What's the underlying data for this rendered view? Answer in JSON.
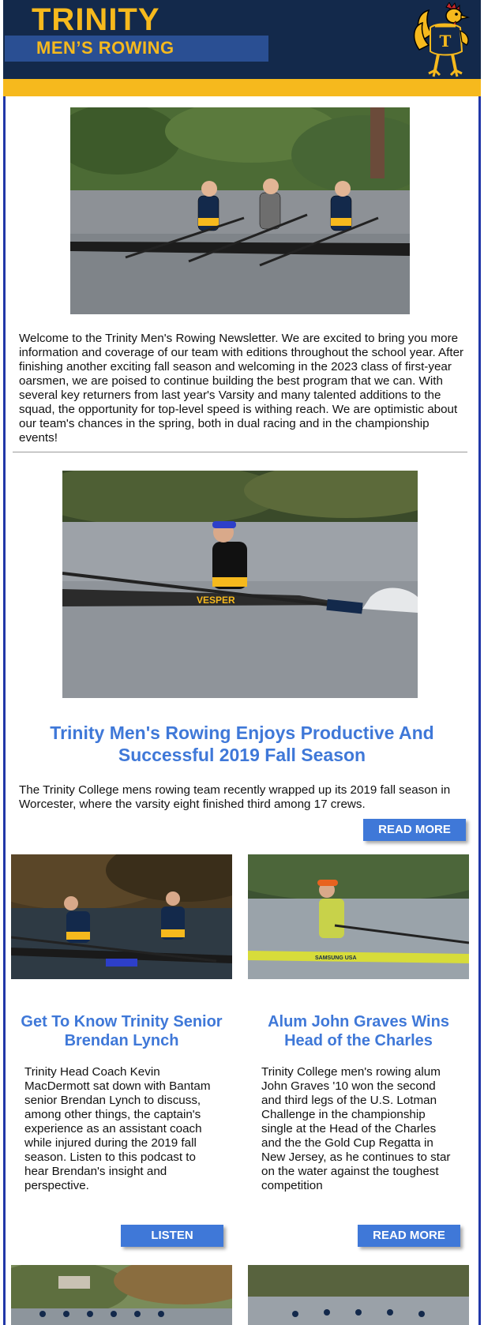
{
  "header": {
    "title": "TRINITY",
    "subtitle": "MEN’S ROWING",
    "mascot_icon": "bantam-mascot-logo"
  },
  "colors": {
    "navy": "#13294b",
    "gold": "#f6b91d",
    "accent_blue": "#3f78d8",
    "frame_border": "#2137a8"
  },
  "intro": {
    "text": "Welcome to the Trinity Men's Rowing Newsletter. We are excited to bring you more information and coverage of our team with editions throughout the school year. After finishing another exciting fall season and welcoming in the 2023 class of first-year oarsmen, we are poised to continue building the best program that we can. With several key returners from last year's Varsity and many talented additions to the squad, the opportunity for top-level speed is withing reach. We are optimistic about our team's chances in the spring, both in dual racing and in the championship events!"
  },
  "feature": {
    "headline": "Trinity Men's Rowing Enjoys Productive And Successful 2019 Fall Season",
    "summary": "The Trinity College mens rowing team recently wrapped up its 2019 fall season in Worcester, where the varsity eight finished third among 17 crews.",
    "button_label": "READ MORE"
  },
  "columns": [
    {
      "headline": "Get To Know Trinity Senior Brendan Lynch",
      "text": "Trinity Head Coach Kevin MacDermott sat down with Bantam senior Brendan Lynch to discuss, among other things, the captain's experience as an assistant coach while injured during the 2019 fall season. Listen to this podcast to hear Brendan's insight and perspective.",
      "button_label": "LISTEN"
    },
    {
      "headline": "Alum John Graves Wins Head of the Charles",
      "text": "Trinity College men's rowing alum John Graves '10 won the second and third legs of the U.S. Lotman Challenge in the championship single at the Head of the Charles and the the Gold Cup Regatta in New Jersey, as he continues to star on the water against the toughest competition",
      "button_label": "READ MORE"
    }
  ],
  "photo_text": {
    "boat_name": "VESPER",
    "boat_brand": "SAMSUNG USA"
  }
}
